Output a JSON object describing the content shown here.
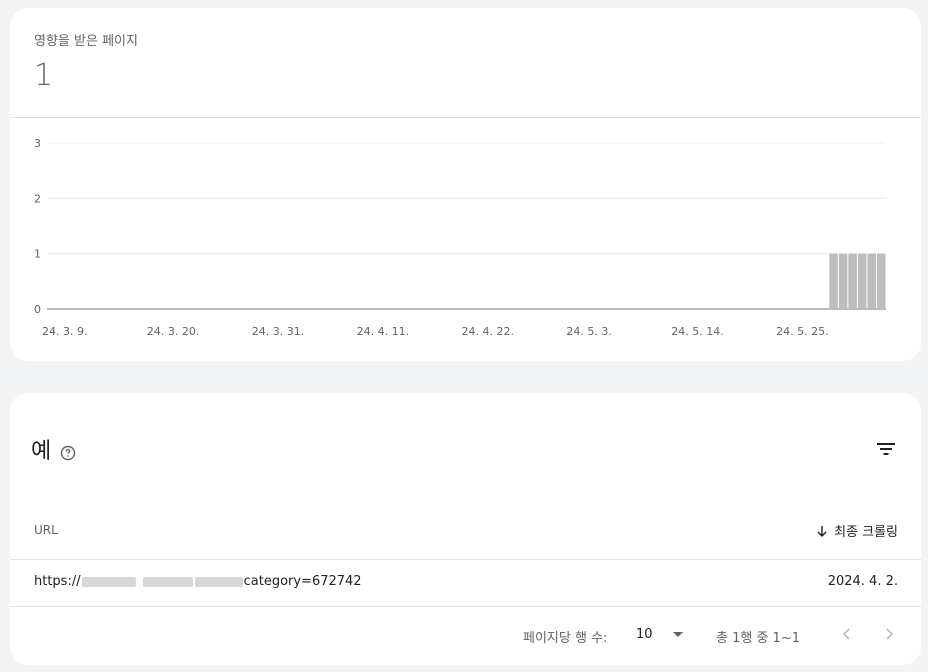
{
  "summary": {
    "label": "영향을 받은 페이지",
    "value": "1"
  },
  "chart_data": {
    "type": "bar",
    "y_ticks": [
      "0",
      "1",
      "2",
      "3"
    ],
    "ylim": [
      0,
      3
    ],
    "x_tick_labels": [
      "24. 3. 9.",
      "24. 3. 20.",
      "24. 3. 31.",
      "24. 4. 11.",
      "24. 4. 22.",
      "24. 5. 3.",
      "24. 5. 14.",
      "24. 5. 25."
    ],
    "x_start": "24. 3. 9.",
    "days_total": 88,
    "series": [
      {
        "values_by_day_index": {
          "82": 1,
          "83": 1,
          "84": 1,
          "85": 1,
          "86": 1,
          "87": 1
        }
      }
    ],
    "bar_color": "#bdbdbd",
    "grid": true
  },
  "examples": {
    "title": "예",
    "columns": {
      "url": "URL",
      "last_crawl": "최종 크롤링"
    },
    "rows": [
      {
        "url_prefix": "https://",
        "url_suffix": "category=672742",
        "date": "2024. 4. 2."
      }
    ],
    "footer": {
      "rows_per_page_label": "페이지당 행 수:",
      "rows_per_page_value": "10",
      "range_text": "총 1행 중 1~1"
    }
  },
  "icons": {
    "help": "help-circle-icon",
    "filter": "filter-icon",
    "sort": "arrow-down-icon",
    "prev": "chevron-left-icon",
    "next": "chevron-right-icon"
  }
}
